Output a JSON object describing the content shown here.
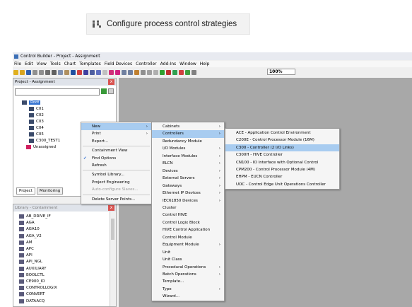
{
  "banner": {
    "title": "Configure process control strategies"
  },
  "window": {
    "title": "Control Builder - Project - Assignment",
    "menus": [
      "File",
      "Edit",
      "View",
      "Tools",
      "Chart",
      "Templates",
      "Field Devices",
      "Controller",
      "Add-Ins",
      "Window",
      "Help"
    ],
    "zoom": "100%"
  },
  "project_pane": {
    "title": "Project - Assignment",
    "tree": [
      "Root",
      "C01",
      "C02",
      "C03",
      "C04",
      "C05",
      "C300_TEST1",
      "Unassigned"
    ],
    "tabs": [
      "Project",
      "Monitoring"
    ]
  },
  "library_pane": {
    "title": "Library - Containment",
    "items": [
      "AB_DRIVE_IF",
      "AGA",
      "AGA10",
      "AGA_V2",
      "AM",
      "APC",
      "API",
      "API_NGL",
      "AUXILIARY",
      "BOOLCTL",
      "CE900_IO",
      "CONTROLLOGIX",
      "CONVERT",
      "DATAACQ"
    ]
  },
  "context_menu": [
    {
      "label": "New",
      "arrow": true,
      "highlight": true
    },
    {
      "label": "Print",
      "arrow": true
    },
    {
      "label": "Export..."
    },
    {
      "label": "Containment View"
    },
    {
      "label": "Find Options",
      "checked": true
    },
    {
      "label": "Refresh"
    },
    {
      "label": "Symbol Library..."
    },
    {
      "label": "Project Engineering"
    },
    {
      "label": "Auto-configure Slaves...",
      "disabled": true
    },
    {
      "label": "Delete Server Points..."
    }
  ],
  "new_menu": [
    {
      "label": "Cabinets",
      "arrow": true
    },
    {
      "label": "Controllers",
      "arrow": true,
      "highlight": true
    },
    {
      "label": "Redundancy Module"
    },
    {
      "label": "I/O Modules",
      "arrow": true
    },
    {
      "label": "Interface Modules",
      "arrow": true
    },
    {
      "label": "ELCN",
      "arrow": true
    },
    {
      "label": "Devices",
      "arrow": true
    },
    {
      "label": "External Servers",
      "arrow": true
    },
    {
      "label": "Gateways",
      "arrow": true
    },
    {
      "label": "Ethernet IP Devices",
      "arrow": true
    },
    {
      "label": "IEC61850 Devices",
      "arrow": true
    },
    {
      "label": "Cluster"
    },
    {
      "label": "Control HIVE"
    },
    {
      "label": "Control Logix Block"
    },
    {
      "label": "HIVE Control Application"
    },
    {
      "label": "Control Module"
    },
    {
      "label": "Equipment Module",
      "arrow": true
    },
    {
      "label": "Unit"
    },
    {
      "label": "Unit Class"
    },
    {
      "label": "Procedural Operations",
      "arrow": true
    },
    {
      "label": "Batch Operations",
      "arrow": true
    },
    {
      "label": "Template..."
    },
    {
      "label": "Type",
      "arrow": true
    },
    {
      "label": "Wizard..."
    }
  ],
  "controllers_menu": [
    {
      "label": "ACE - Application Control Environment"
    },
    {
      "label": "C200E - Control Processor Module (16M)"
    },
    {
      "label": "C300 - Controller (2 I/O Links)",
      "highlight": true
    },
    {
      "label": "C300H - HIVE Controller"
    },
    {
      "label": "CN100 - IO Interface with Optional Control"
    },
    {
      "label": "CPM200 - Control Processor Module (4M)"
    },
    {
      "label": "EHPM - EUCN Controller"
    },
    {
      "label": "UOC - Control Edge Unit Operations Controller"
    }
  ]
}
